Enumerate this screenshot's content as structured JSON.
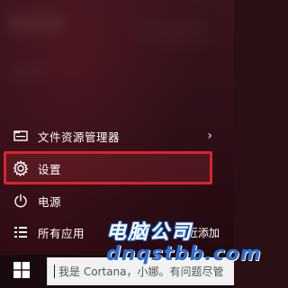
{
  "menu": {
    "file_explorer": {
      "label": "文件资源管理器",
      "icon": "folder-icon",
      "chevron": "›"
    },
    "settings": {
      "label": "设置",
      "icon": "gear-icon"
    },
    "power": {
      "label": "电源",
      "icon": "power-icon"
    },
    "all_apps": {
      "label": "所有应用",
      "icon": "list-icon",
      "right_label": "最近添加"
    }
  },
  "taskbar": {
    "search_text": "我是 Cortana，小娜。有问题尽管"
  },
  "watermark": {
    "line1": "电脑公司",
    "line2": "dnqstbb.com"
  },
  "colors": {
    "highlight": "#d9232d",
    "panel": "#2c0f16",
    "taskbar": "#1a0a0e",
    "watermark_blue": "#2a6fd1"
  }
}
